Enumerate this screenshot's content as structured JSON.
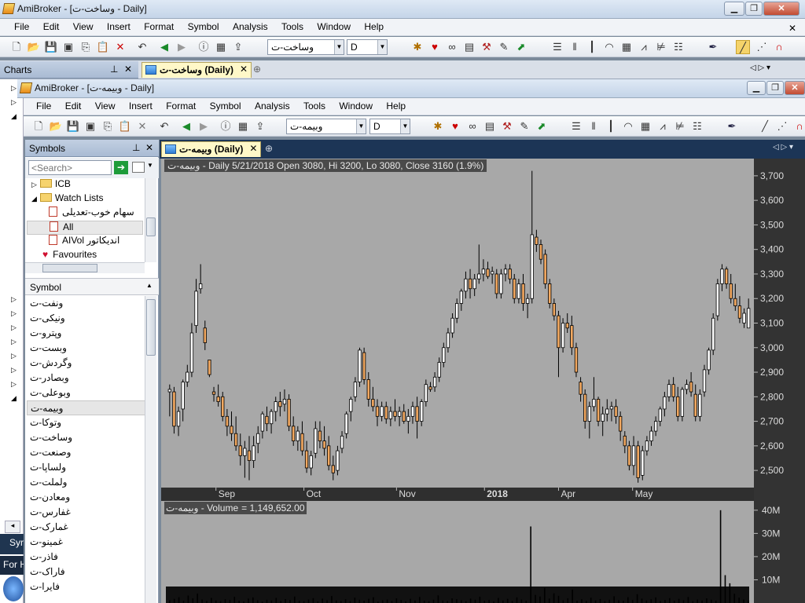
{
  "outer": {
    "title": "AmiBroker - [وساخت-ت  -  Daily]",
    "menu": [
      "File",
      "Edit",
      "View",
      "Insert",
      "Format",
      "Symbol",
      "Analysis",
      "Tools",
      "Window",
      "Help"
    ],
    "symbol_combo": "وساخت-ت",
    "interval_combo": "D",
    "charts_panel": "Charts",
    "tab_label": "وساخت-ت (Daily)"
  },
  "inner": {
    "title": "AmiBroker - [وبیمه-ت  -  Daily]",
    "menu": [
      "File",
      "Edit",
      "View",
      "Insert",
      "Format",
      "Symbol",
      "Analysis",
      "Tools",
      "Window",
      "Help"
    ],
    "symbol_combo": "وبیمه-ت",
    "interval_combo": "D",
    "tab_label": "وبیمه-ت (Daily)"
  },
  "symbols_panel": {
    "title": "Symbols",
    "search_placeholder": "<Search>",
    "tree": [
      {
        "label": "ICB",
        "kind": "folder",
        "expanded": false
      },
      {
        "label": "Watch Lists",
        "kind": "folder",
        "expanded": true
      },
      {
        "label": "سهام خوب-تعدیلی",
        "kind": "watchlist"
      },
      {
        "label": "All",
        "kind": "watchlist",
        "selected": true
      },
      {
        "label": "AIVol اندیکاتور",
        "kind": "watchlist"
      },
      {
        "label": "Favourites",
        "kind": "favourites"
      }
    ],
    "list_header": "Symbol",
    "symbols": [
      "ونفت-ت",
      "ونیکی-ت",
      "وپترو-ت",
      "وبست-ت",
      "وگردش-ت",
      "وبصادر-ت",
      "وبوعلی-ت",
      "وبیمه-ت",
      "وتوکا-ت",
      "وساخت-ت",
      "وصنعت-ت",
      "ولساپا-ت",
      "ولملت-ت",
      "ومعادن-ت",
      "غفارس-ت",
      "غمارک-ت",
      "غمینو-ت",
      "فاذر-ت",
      "فاراک-ت",
      "فایرا-ت"
    ],
    "selected_symbol": "وبیمه-ت"
  },
  "left_strip": {
    "label_1": "Syr",
    "label_2": "For H"
  },
  "chart": {
    "header": "وبیمه-ت - Daily 5/21/2018 Open 3080, Hi 3200, Lo 3080, Close 3160 (1.9%)",
    "volume_header_name": "وبیمه-ت - Volume",
    "volume_header_value": "= 1,149,652.00",
    "price_ticks": [
      "3,700",
      "3,600",
      "3,500",
      "3,400",
      "3,300",
      "3,200",
      "3,100",
      "3,000",
      "2,900",
      "2,800",
      "2,700",
      "2,600",
      "2,500"
    ],
    "volume_ticks": [
      "40M",
      "30M",
      "20M",
      "10M"
    ],
    "x_labels": [
      {
        "text": "Sep",
        "bold": false
      },
      {
        "text": "Oct",
        "bold": false
      },
      {
        "text": "Nov",
        "bold": false
      },
      {
        "text": "2018",
        "bold": true
      },
      {
        "text": "Apr",
        "bold": false
      },
      {
        "text": "May",
        "bold": false
      }
    ],
    "colors": {
      "up": "#ffffff",
      "down": "#f2a860",
      "bg": "#a8a8a8",
      "axis": "#333333"
    }
  },
  "chart_data": {
    "type": "candlestick",
    "title": "وبیمه-ت - Daily 5/21/2018 Open 3080, Hi 3200, Lo 3080, Close 3160 (1.9%)",
    "ylim": [
      2430,
      3770
    ],
    "volume_ylim": [
      0,
      44000000
    ],
    "candles": [
      [
        2820,
        2850,
        2720,
        2830
      ],
      [
        2820,
        2840,
        2650,
        2680
      ],
      [
        2680,
        2760,
        2640,
        2740
      ],
      [
        2750,
        2870,
        2700,
        2860
      ],
      [
        2860,
        2930,
        2840,
        2900
      ],
      [
        2900,
        3100,
        2880,
        3060
      ],
      [
        3090,
        3280,
        3060,
        3230
      ],
      [
        3240,
        3340,
        3220,
        3260
      ],
      [
        3080,
        3110,
        2990,
        3020
      ],
      [
        2950,
        2950,
        2880,
        2890
      ],
      [
        2820,
        2840,
        2780,
        2810
      ],
      [
        2800,
        2850,
        2760,
        2780
      ],
      [
        2800,
        2820,
        2700,
        2720
      ],
      [
        2720,
        2750,
        2640,
        2680
      ],
      [
        2680,
        2740,
        2620,
        2650
      ],
      [
        2650,
        2720,
        2580,
        2600
      ],
      [
        2600,
        2650,
        2520,
        2560
      ],
      [
        2560,
        2620,
        2470,
        2590
      ],
      [
        2580,
        2640,
        2460,
        2540
      ],
      [
        2540,
        2640,
        2510,
        2600
      ],
      [
        2610,
        2680,
        2570,
        2650
      ],
      [
        2660,
        2740,
        2630,
        2730
      ],
      [
        2720,
        2760,
        2660,
        2690
      ],
      [
        2690,
        2750,
        2650,
        2740
      ],
      [
        2740,
        2800,
        2700,
        2780
      ],
      [
        2780,
        2820,
        2720,
        2760
      ],
      [
        2770,
        2830,
        2740,
        2790
      ],
      [
        2790,
        2810,
        2660,
        2680
      ],
      [
        2680,
        2720,
        2600,
        2620
      ],
      [
        2620,
        2680,
        2580,
        2660
      ],
      [
        2650,
        2700,
        2560,
        2580
      ],
      [
        2580,
        2620,
        2490,
        2510
      ],
      [
        2510,
        2580,
        2480,
        2560
      ],
      [
        2570,
        2700,
        2550,
        2670
      ],
      [
        2660,
        2700,
        2590,
        2620
      ],
      [
        2620,
        2680,
        2560,
        2590
      ],
      [
        2600,
        2640,
        2500,
        2520
      ],
      [
        2520,
        2560,
        2460,
        2490
      ],
      [
        2500,
        2600,
        2480,
        2580
      ],
      [
        2590,
        2660,
        2570,
        2640
      ],
      [
        2650,
        2740,
        2630,
        2730
      ],
      [
        2740,
        2800,
        2700,
        2790
      ],
      [
        2800,
        2880,
        2780,
        2860
      ],
      [
        2860,
        3000,
        2840,
        2990
      ],
      [
        2980,
        3000,
        2850,
        2870
      ],
      [
        2870,
        2900,
        2760,
        2790
      ],
      [
        2790,
        2840,
        2740,
        2760
      ],
      [
        2760,
        2790,
        2680,
        2720
      ],
      [
        2720,
        2780,
        2700,
        2760
      ],
      [
        2760,
        2780,
        2690,
        2710
      ],
      [
        2710,
        2760,
        2680,
        2740
      ],
      [
        2740,
        2790,
        2700,
        2720
      ],
      [
        2720,
        2760,
        2680,
        2740
      ],
      [
        2740,
        2770,
        2690,
        2700
      ],
      [
        2700,
        2750,
        2650,
        2720
      ],
      [
        2720,
        2780,
        2690,
        2760
      ],
      [
        2760,
        2800,
        2630,
        2700
      ],
      [
        2700,
        2790,
        2680,
        2780
      ],
      [
        2780,
        2870,
        2760,
        2850
      ],
      [
        2840,
        2860,
        2820,
        2830
      ],
      [
        2840,
        2900,
        2820,
        2880
      ],
      [
        2880,
        2960,
        2860,
        2940
      ],
      [
        2940,
        3020,
        2920,
        3000
      ],
      [
        3000,
        3080,
        2980,
        3060
      ],
      [
        3060,
        3140,
        3040,
        3120
      ],
      [
        3120,
        3200,
        3100,
        3180
      ],
      [
        3180,
        3240,
        3150,
        3230
      ],
      [
        3230,
        3310,
        3200,
        3280
      ],
      [
        3280,
        3320,
        3200,
        3240
      ],
      [
        3240,
        3300,
        3210,
        3280
      ],
      [
        3280,
        3420,
        3260,
        3300
      ],
      [
        3300,
        3360,
        3270,
        3320
      ],
      [
        3320,
        3350,
        3280,
        3290
      ],
      [
        3300,
        3330,
        3260,
        3310
      ],
      [
        3300,
        3320,
        3200,
        3220
      ],
      [
        3220,
        3320,
        3200,
        3300
      ],
      [
        3300,
        3340,
        3270,
        3320
      ],
      [
        3320,
        3340,
        3260,
        3280
      ],
      [
        3280,
        3300,
        3180,
        3200
      ],
      [
        3200,
        3280,
        3180,
        3260
      ],
      [
        3260,
        3300,
        3150,
        3180
      ],
      [
        3180,
        3220,
        3120,
        3200
      ],
      [
        3200,
        3720,
        3180,
        3460
      ],
      [
        3450,
        3480,
        3390,
        3420
      ],
      [
        3420,
        3440,
        3340,
        3360
      ],
      [
        3380,
        3400,
        3240,
        3260
      ],
      [
        3260,
        3280,
        3160,
        3180
      ],
      [
        3180,
        3200,
        3110,
        3130
      ],
      [
        3130,
        3150,
        2880,
        3000
      ],
      [
        3000,
        3120,
        2980,
        3100
      ],
      [
        3100,
        3140,
        3060,
        3080
      ],
      [
        3090,
        3130,
        2970,
        3000
      ],
      [
        3000,
        3020,
        2880,
        2900
      ],
      [
        2860,
        2880,
        2780,
        2810
      ],
      [
        2810,
        2830,
        2670,
        2700
      ],
      [
        2700,
        2780,
        2630,
        2760
      ],
      [
        2760,
        2880,
        2740,
        2790
      ],
      [
        2790,
        2800,
        2680,
        2700
      ],
      [
        2700,
        2760,
        2640,
        2730
      ],
      [
        2730,
        2790,
        2700,
        2750
      ],
      [
        2750,
        2780,
        2700,
        2760
      ],
      [
        2760,
        2790,
        2690,
        2720
      ],
      [
        2720,
        2740,
        2620,
        2660
      ],
      [
        2640,
        2660,
        2570,
        2600
      ],
      [
        2600,
        2620,
        2500,
        2520
      ],
      [
        2520,
        2640,
        2480,
        2600
      ],
      [
        2600,
        2620,
        2450,
        2470
      ],
      [
        2480,
        2600,
        2460,
        2580
      ],
      [
        2580,
        2640,
        2560,
        2620
      ],
      [
        2620,
        2680,
        2600,
        2660
      ],
      [
        2660,
        2720,
        2640,
        2700
      ],
      [
        2700,
        2760,
        2680,
        2750
      ],
      [
        2750,
        2820,
        2720,
        2800
      ],
      [
        2800,
        2870,
        2780,
        2850
      ],
      [
        2850,
        2880,
        2780,
        2800
      ],
      [
        2800,
        2840,
        2700,
        2720
      ],
      [
        2720,
        2840,
        2700,
        2830
      ],
      [
        2830,
        2870,
        2810,
        2850
      ],
      [
        2860,
        2900,
        2800,
        2820
      ],
      [
        2810,
        2850,
        2700,
        2720
      ],
      [
        2720,
        2830,
        2700,
        2810
      ],
      [
        2820,
        2930,
        2800,
        2910
      ],
      [
        2910,
        3000,
        2890,
        2990
      ],
      [
        2990,
        3140,
        2970,
        3120
      ],
      [
        3130,
        3280,
        3110,
        3260
      ],
      [
        3260,
        3340,
        3230,
        3320
      ],
      [
        3320,
        3330,
        3240,
        3260
      ],
      [
        3260,
        3300,
        3180,
        3200
      ],
      [
        3200,
        3260,
        3150,
        3170
      ],
      [
        3170,
        3210,
        3100,
        3120
      ],
      [
        3100,
        3160,
        3080,
        3140
      ],
      [
        3080,
        3200,
        3080,
        3160
      ]
    ],
    "volumes_millions": [
      1.2,
      1.8,
      2.5,
      1.0,
      3.2,
      2.0,
      4.1,
      1.5,
      0.9,
      2.2,
      1.1,
      0.8,
      1.6,
      1.3,
      2.7,
      1.0,
      0.7,
      1.9,
      2.4,
      1.2,
      0.6,
      1.4,
      1.1,
      2.2,
      0.9,
      1.7,
      1.3,
      2.8,
      1.0,
      0.8,
      1.5,
      2.1,
      0.7,
      1.9,
      1.2,
      3.0,
      1.1,
      0.9,
      1.6,
      0.8,
      2.3,
      1.4,
      1.0,
      1.8,
      2.5,
      0.6,
      1.2,
      1.5,
      0.9,
      2.0,
      1.3,
      0.7,
      1.8,
      1.1,
      2.6,
      1.0,
      0.8,
      1.4,
      3.3,
      1.1,
      0.9,
      2.0,
      1.6,
      1.2,
      0.8,
      1.9,
      1.4,
      2.7,
      1.0,
      1.3,
      0.7,
      2.2,
      1.1,
      1.8,
      0.9,
      2.4,
      1.5,
      1.0,
      33.0,
      3.5,
      2.8,
      6.5,
      1.9,
      4.2,
      3.1,
      1.2,
      2.0,
      5.8,
      1.0,
      1.6,
      0.9,
      2.3,
      1.1,
      1.7,
      0.8,
      1.4,
      2.9,
      1.2,
      1.0,
      2.5,
      1.3,
      3.8,
      1.9,
      1.1,
      1.6,
      2.4,
      0.9,
      1.3,
      2.1,
      1.0,
      1.8,
      1.2,
      2.6,
      0.8,
      1.5,
      1.1,
      2.0,
      1.4,
      1.0,
      40.0,
      12.0,
      8.5,
      4.0,
      2.3,
      1.5,
      1.1
    ]
  }
}
